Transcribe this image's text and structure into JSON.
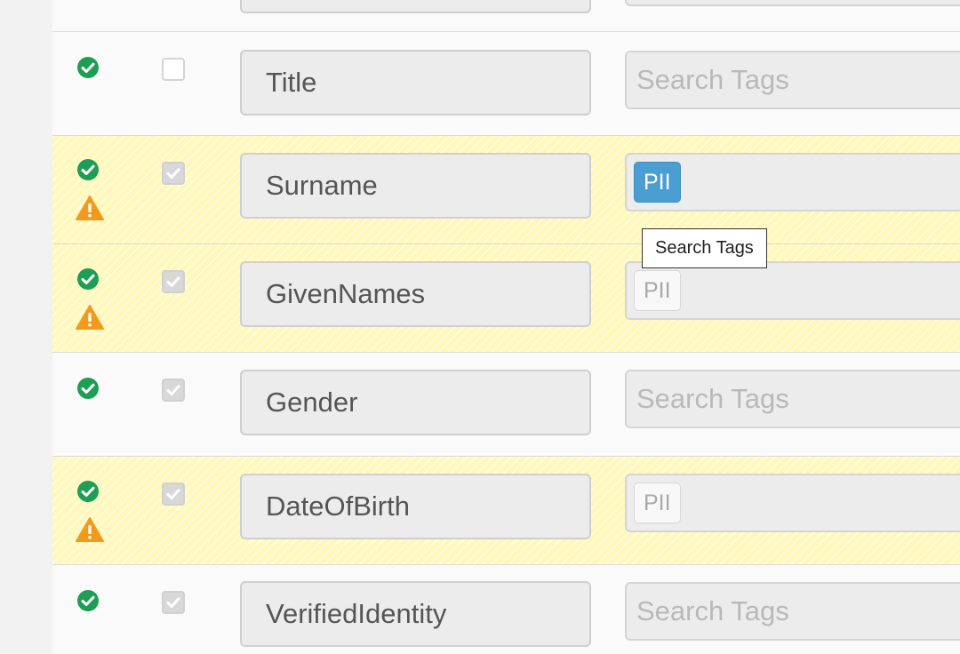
{
  "colors": {
    "ok": "#1e9e55",
    "warning": "#f39a1c",
    "tag_active": "#4a9ed1",
    "warn_row": "#fff8b8"
  },
  "rows": [
    {
      "name": "",
      "status": [
        "check-circle-icon"
      ],
      "selected": false,
      "tags": [],
      "placeholder": ""
    },
    {
      "name": "Title",
      "status": [
        "check-circle-icon"
      ],
      "selected": false,
      "tags": [],
      "placeholder": "Search Tags"
    },
    {
      "name": "Surname",
      "status": [
        "check-circle-icon",
        "warning-triangle-icon"
      ],
      "selected": true,
      "tags": [
        {
          "label": "PII",
          "active": true
        }
      ],
      "placeholder": ""
    },
    {
      "name": "GivenNames",
      "status": [
        "check-circle-icon",
        "warning-triangle-icon"
      ],
      "selected": true,
      "tags": [
        {
          "label": "PII",
          "active": false
        }
      ],
      "placeholder": ""
    },
    {
      "name": "Gender",
      "status": [
        "check-circle-icon"
      ],
      "selected": true,
      "tags": [],
      "placeholder": "Search Tags"
    },
    {
      "name": "DateOfBirth",
      "status": [
        "check-circle-icon",
        "warning-triangle-icon"
      ],
      "selected": true,
      "tags": [
        {
          "label": "PII",
          "active": false
        }
      ],
      "placeholder": ""
    },
    {
      "name": "VerifiedIdentity",
      "status": [
        "check-circle-icon"
      ],
      "selected": true,
      "tags": [],
      "placeholder": "Search Tags"
    }
  ],
  "tooltip": {
    "text": "Search Tags"
  }
}
